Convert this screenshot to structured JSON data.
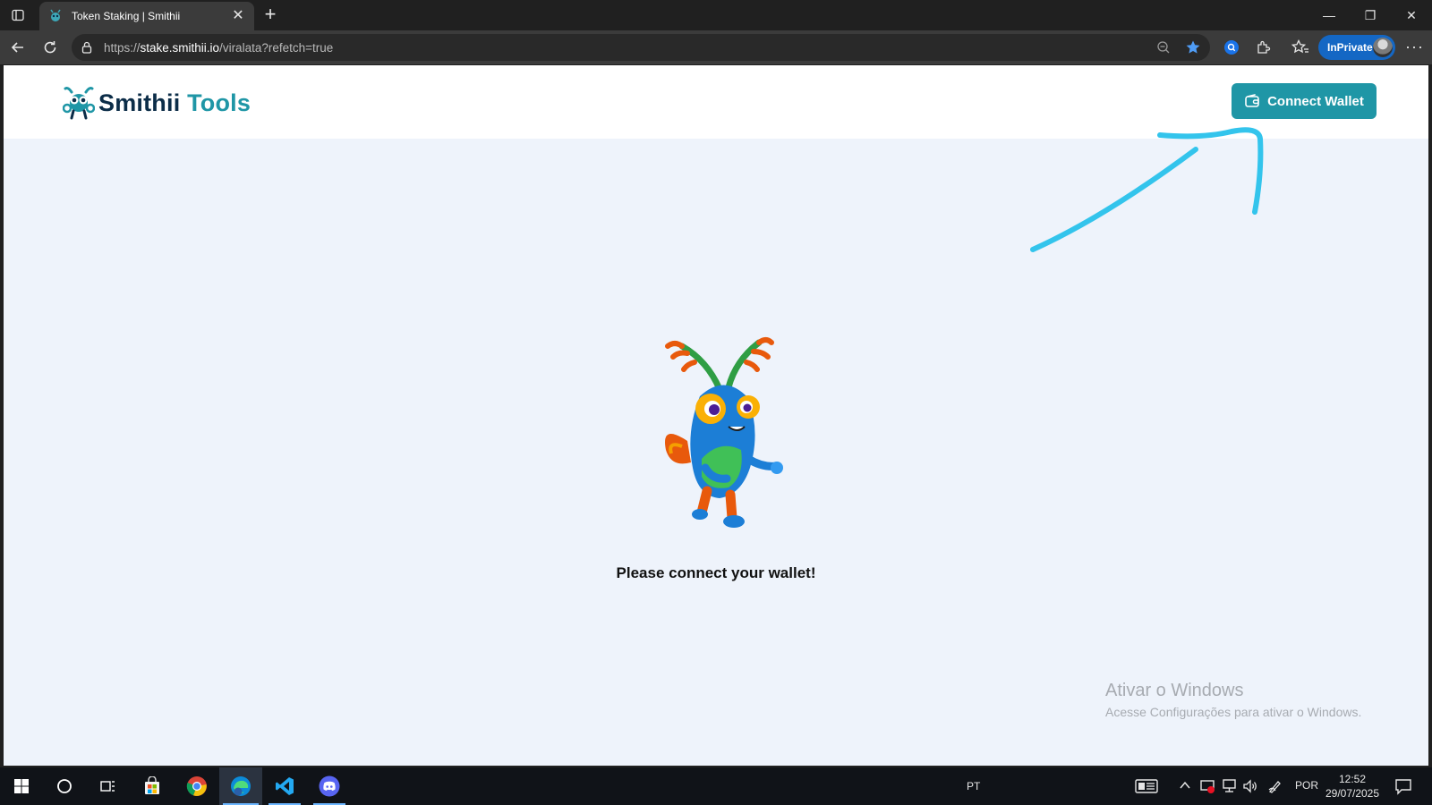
{
  "browser": {
    "tab_title": "Token Staking | Smithii",
    "tab_close": "✕",
    "new_tab": "+",
    "url_scheme": "https://",
    "url_host": "stake.smithii.io",
    "url_path": "/viralata?refetch=true",
    "inprivate_label": "InPrivate",
    "more_label": "···",
    "window_controls": {
      "minimize": "—",
      "restore": "❐",
      "close": "✕"
    }
  },
  "site": {
    "logo_word1": "Smithii",
    "logo_word2": "Tools",
    "connect_wallet_label": "Connect Wallet",
    "message": "Please connect your wallet!",
    "accent_color": "#1f96a6",
    "annotation_color": "#33c4ec"
  },
  "watermark": {
    "line1": "Ativar o Windows",
    "line2": "Acesse Configurações para ativar o Windows."
  },
  "taskbar": {
    "language_indicator": "PT",
    "input_language": "POR",
    "time": "12:52",
    "date": "29/07/2025"
  }
}
